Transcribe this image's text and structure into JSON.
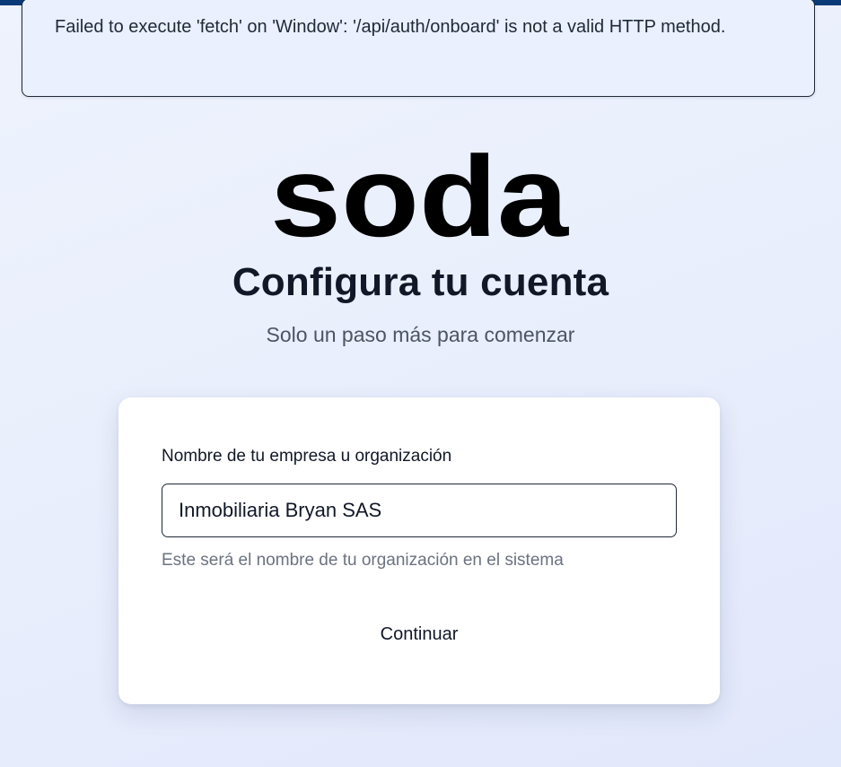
{
  "error_toast": {
    "message": "Failed to execute 'fetch' on 'Window': '/api/auth/onboard' is not a valid HTTP method."
  },
  "brand": {
    "logo_text": "soda"
  },
  "header": {
    "title": "Configura tu cuenta",
    "subtitle": "Solo un paso más para comenzar"
  },
  "form": {
    "org_label": "Nombre de tu empresa u organización",
    "org_value": "Inmobiliaria Bryan SAS",
    "org_help": "Este será el nombre de tu organización en el sistema",
    "submit_label": "Continuar"
  },
  "colors": {
    "top_bar": "#0b3a78",
    "background": "#eaf0fd",
    "title": "#111827",
    "muted": "#6b7280"
  }
}
